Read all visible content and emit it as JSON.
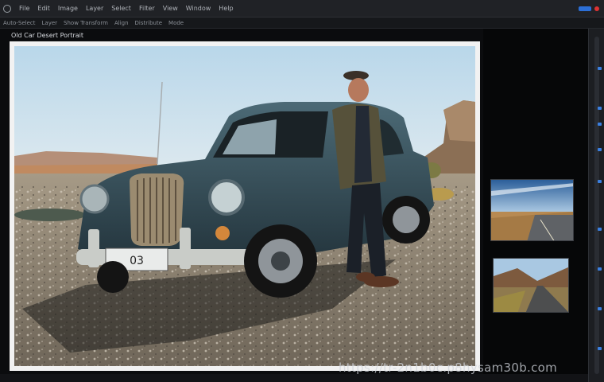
{
  "menubar": {
    "items": [
      "File",
      "Edit",
      "Image",
      "Layer",
      "Select",
      "Filter",
      "View",
      "Window",
      "Help"
    ]
  },
  "toolbar": {
    "items": [
      "Auto-Select",
      "Layer",
      "Show Transform",
      "Align",
      "Distribute",
      "Mode"
    ]
  },
  "document": {
    "title": "Old Car Desert Portrait"
  },
  "photo": {
    "plate_text": "03"
  },
  "thumbnails": [
    {
      "name": "desert-highway-blue-sky"
    },
    {
      "name": "desert-road-hills"
    }
  ],
  "watermark": {
    "text": "https://tr-2n1b0c.p8hysam30b.com"
  },
  "colors": {
    "accent": "#3a7fe0",
    "canvas_border": "#f2f2f2",
    "app_bg": "#0b0c0e"
  }
}
